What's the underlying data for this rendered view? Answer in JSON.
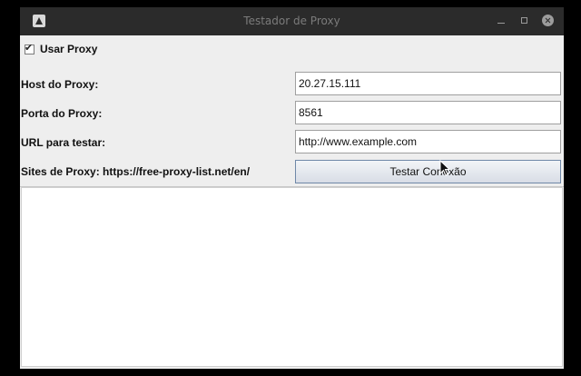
{
  "window": {
    "title": "Testador de Proxy"
  },
  "proxy": {
    "use_proxy_label": "Usar Proxy",
    "use_proxy_checked": true,
    "host_label": "Host do Proxy:",
    "host_value": "20.27.15.111",
    "port_label": "Porta do Proxy:",
    "port_value": "8561",
    "url_label": "URL para testar:",
    "url_value": "http://www.example.com",
    "sites_label": "Sites de Proxy: https://free-proxy-list.net/en/",
    "test_button_label": "Testar Conexão"
  },
  "output": {
    "text": ""
  }
}
